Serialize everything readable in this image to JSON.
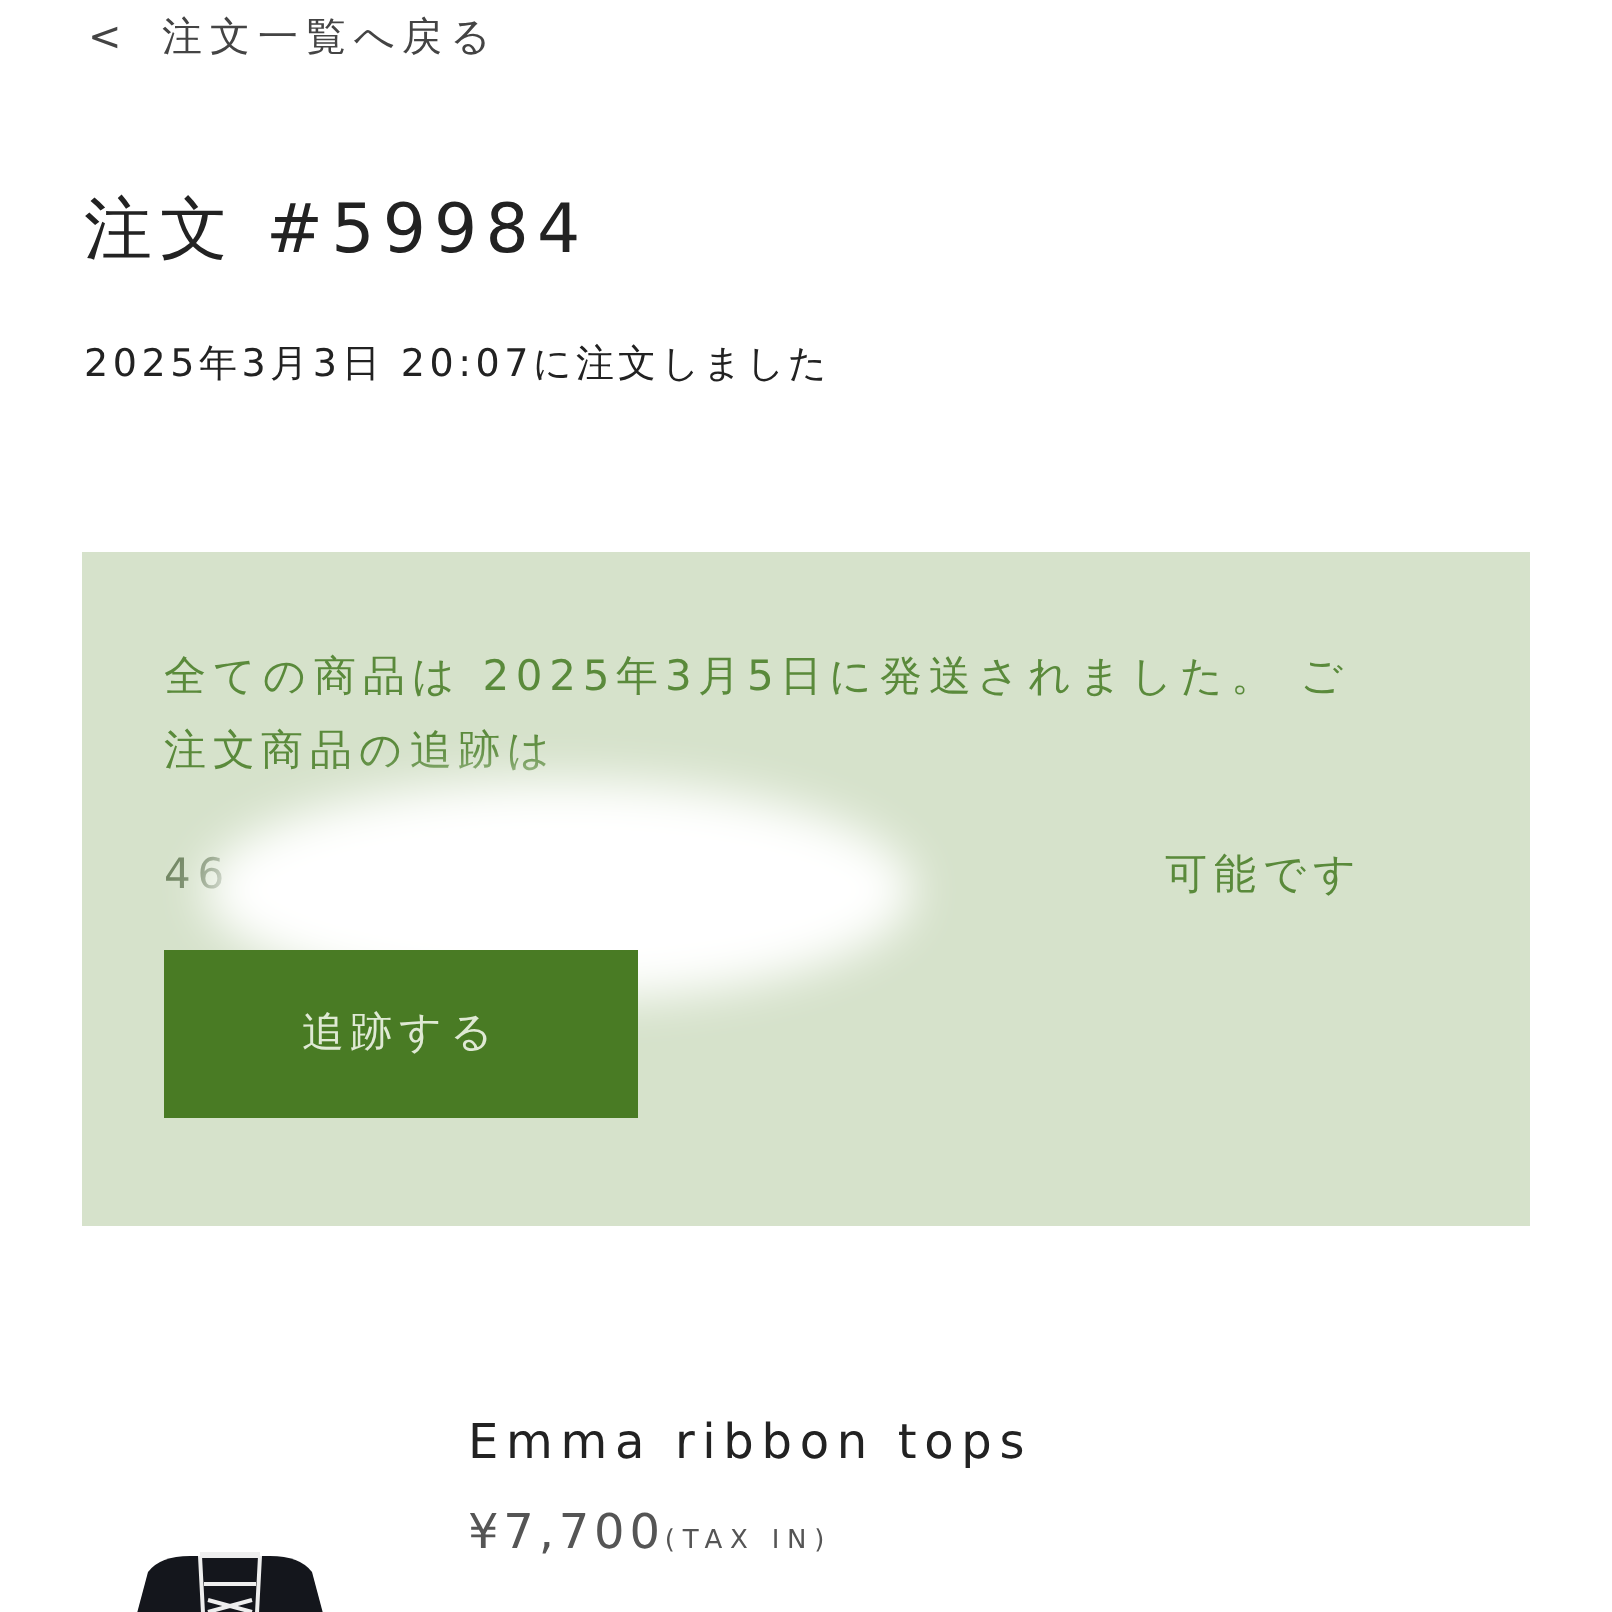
{
  "back_link": {
    "icon": "<",
    "label": "注文一覧へ戻る"
  },
  "order": {
    "title": "注文 #59984",
    "placed_at": "2025年3月3日 20:07に注文しました"
  },
  "shipping_notice": {
    "message": "全ての商品は 2025年3月5日に発送されました。 ご注文商品の追跡は",
    "tracking_visible": "46",
    "tracking_suffix": "可能です",
    "button": "追跡する"
  },
  "items": [
    {
      "name": "Emma ribbon tops",
      "price": "¥7,700",
      "tax_note": "(TAX IN)"
    }
  ]
}
